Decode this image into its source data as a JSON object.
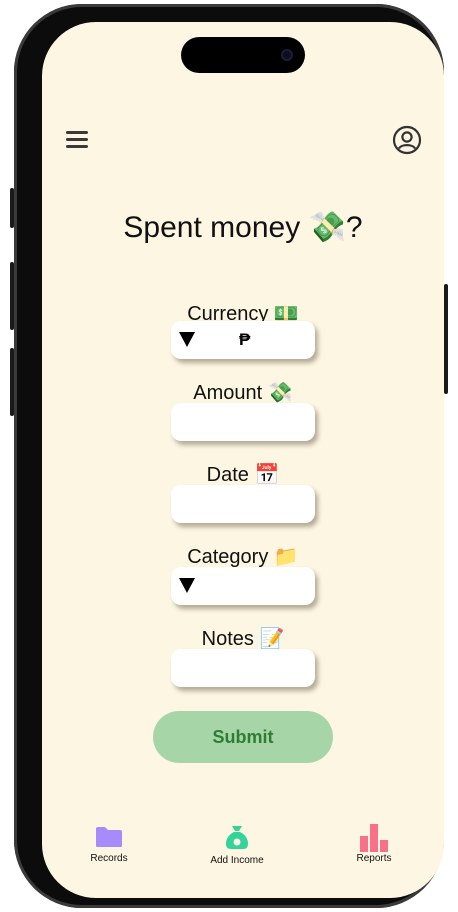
{
  "header": {
    "menu_icon": "hamburger-menu-icon",
    "profile_icon": "user-circle-icon"
  },
  "title": "Spent money 💸?",
  "form": {
    "currency": {
      "label": "Currency 💵",
      "selected": "₱"
    },
    "amount": {
      "label": "Amount 💸",
      "value": ""
    },
    "date": {
      "label": "Date 📅",
      "value": ""
    },
    "category": {
      "label": "Category 📁",
      "selected": ""
    },
    "notes": {
      "label": "Notes 📝",
      "value": ""
    }
  },
  "submit_label": "Submit",
  "bottom_nav": {
    "records": {
      "label": "Records",
      "icon": "folder-icon",
      "color": "#a78bfa"
    },
    "add_income": {
      "label": "Add Income",
      "icon": "money-bag-icon",
      "color": "#34d399"
    },
    "reports": {
      "label": "Reports",
      "icon": "bar-chart-icon",
      "color": "#f87189"
    }
  },
  "colors": {
    "background": "#fdf6e2",
    "submit_bg": "#a6d6a8",
    "submit_text": "#2e7d33"
  }
}
